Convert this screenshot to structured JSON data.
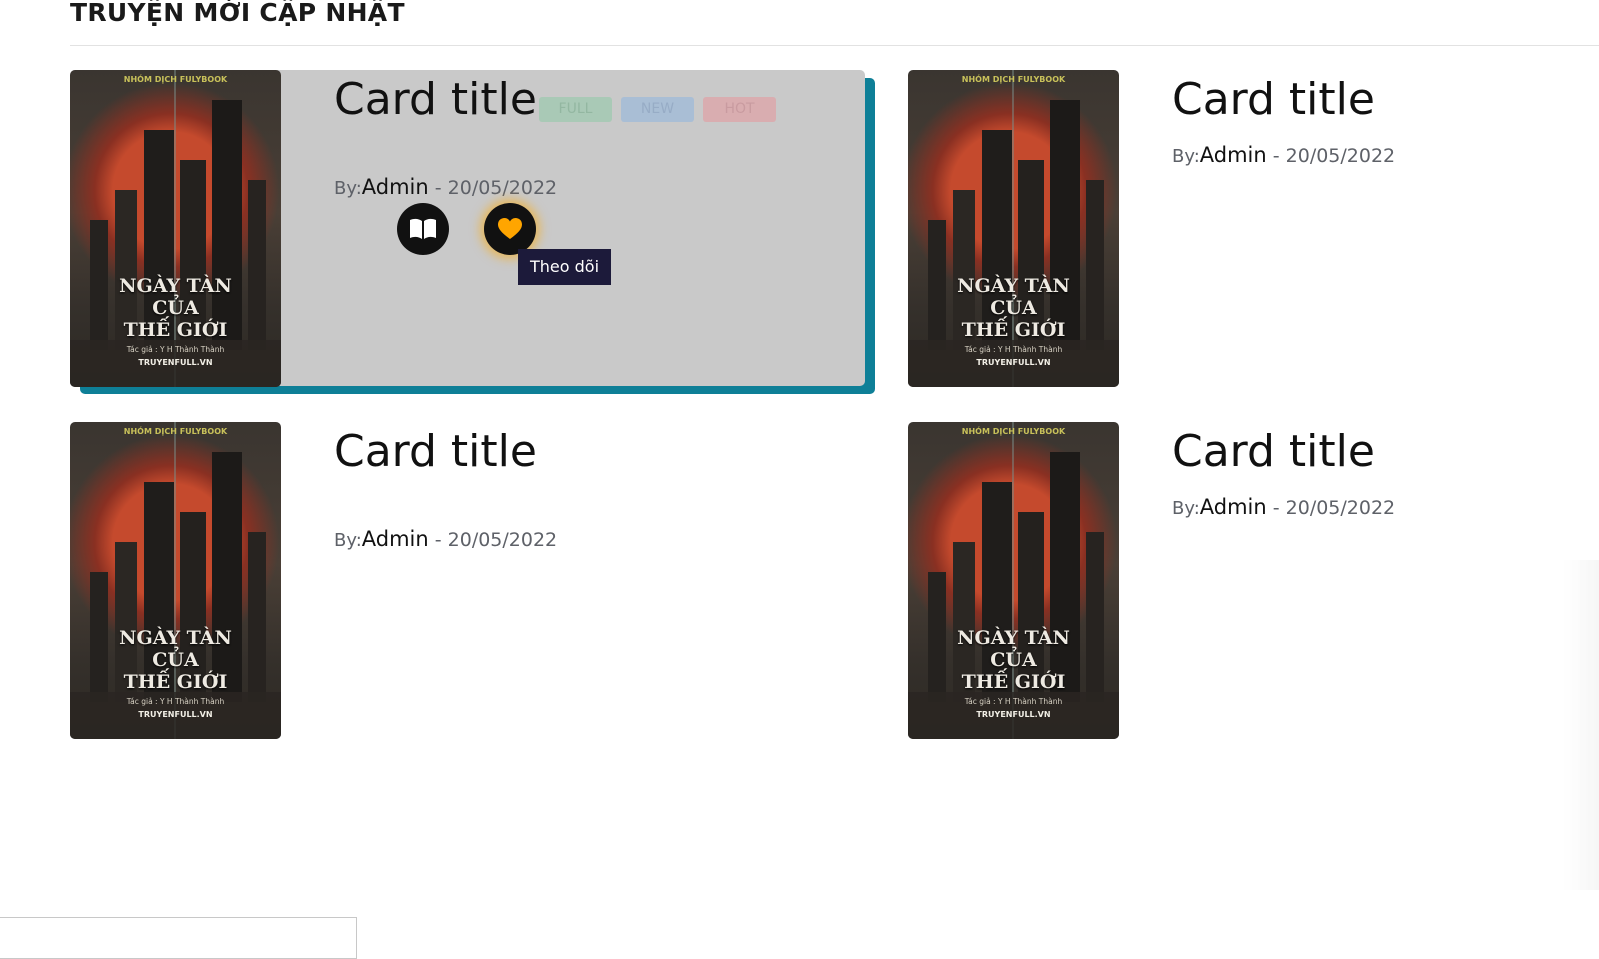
{
  "section": {
    "title": "TRUYỆN MỚI CẬP NHẬT"
  },
  "cover": {
    "team": "NHÓM DỊCH FULYBOOK",
    "title_lines": [
      "NGÀY TÀN",
      "CỦA",
      "THẾ GIỚI"
    ],
    "author": "Tác giả : Y H Thành Thành",
    "site": "TRUYENFULL.VN"
  },
  "cards": [
    {
      "title": "Card title",
      "by_label": "By:",
      "author": "Admin",
      "separator": " - ",
      "date": "20/05/2022",
      "badges": [
        "FULL",
        "NEW",
        "HOT"
      ],
      "tooltip": "Theo dõi",
      "read_icon": "book-open-icon",
      "follow_icon": "heart-icon"
    },
    {
      "title": "Card title",
      "by_label": "By:",
      "author": "Admin",
      "separator": " - ",
      "date": "20/05/2022"
    },
    {
      "title": "Card title",
      "by_label": "By:",
      "author": "Admin",
      "separator": " - ",
      "date": "20/05/2022"
    },
    {
      "title": "Card title",
      "by_label": "By:",
      "author": "Admin",
      "separator": " - ",
      "date": "20/05/2022"
    }
  ],
  "colors": {
    "accent_shadow": "#0e7f97",
    "hover_panel": "#c9c9c9",
    "follow_heart": "#ffa500",
    "tooltip_bg": "#1c1a3a"
  }
}
